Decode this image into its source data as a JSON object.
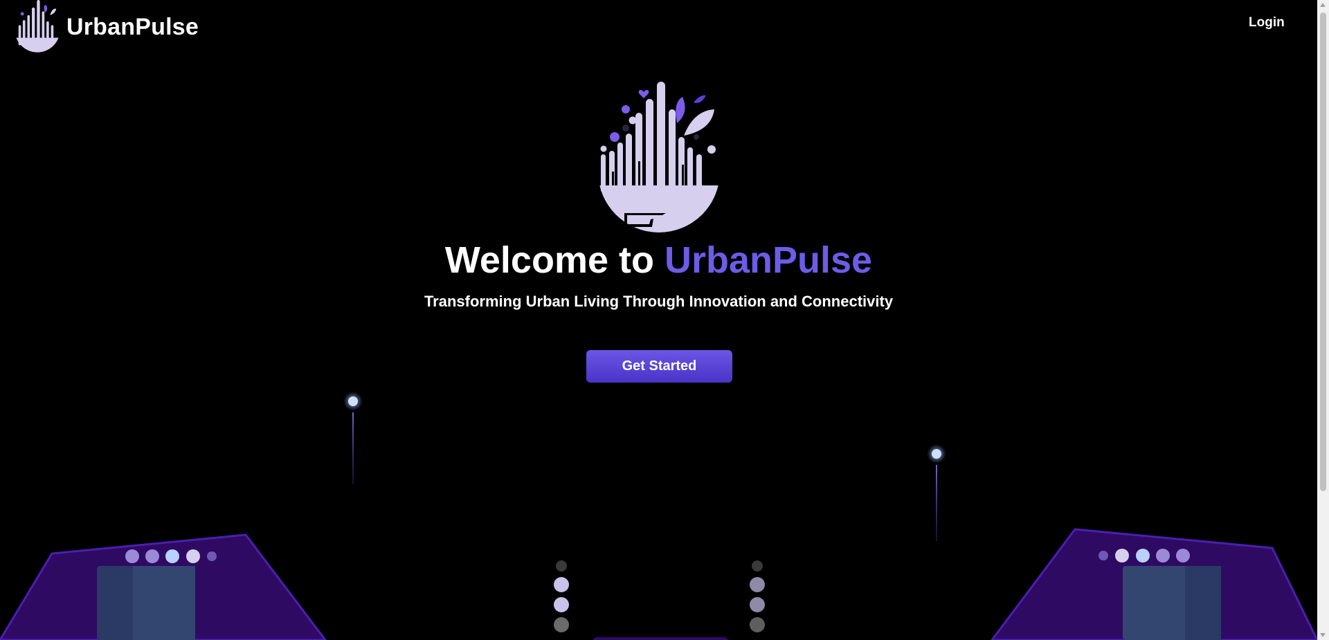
{
  "nav": {
    "brand": "UrbanPulse",
    "login": "Login"
  },
  "hero": {
    "headline_prefix": "Welcome to",
    "headline_accent": "UrbanPulse",
    "subtitle": "Transforming Urban Living Through Innovation and Connectivity",
    "cta": "Get Started"
  },
  "colors": {
    "accent": "#6c5ce7",
    "background": "#000000",
    "logo_light": "#d6d0ee",
    "building": "#2f0a63"
  }
}
